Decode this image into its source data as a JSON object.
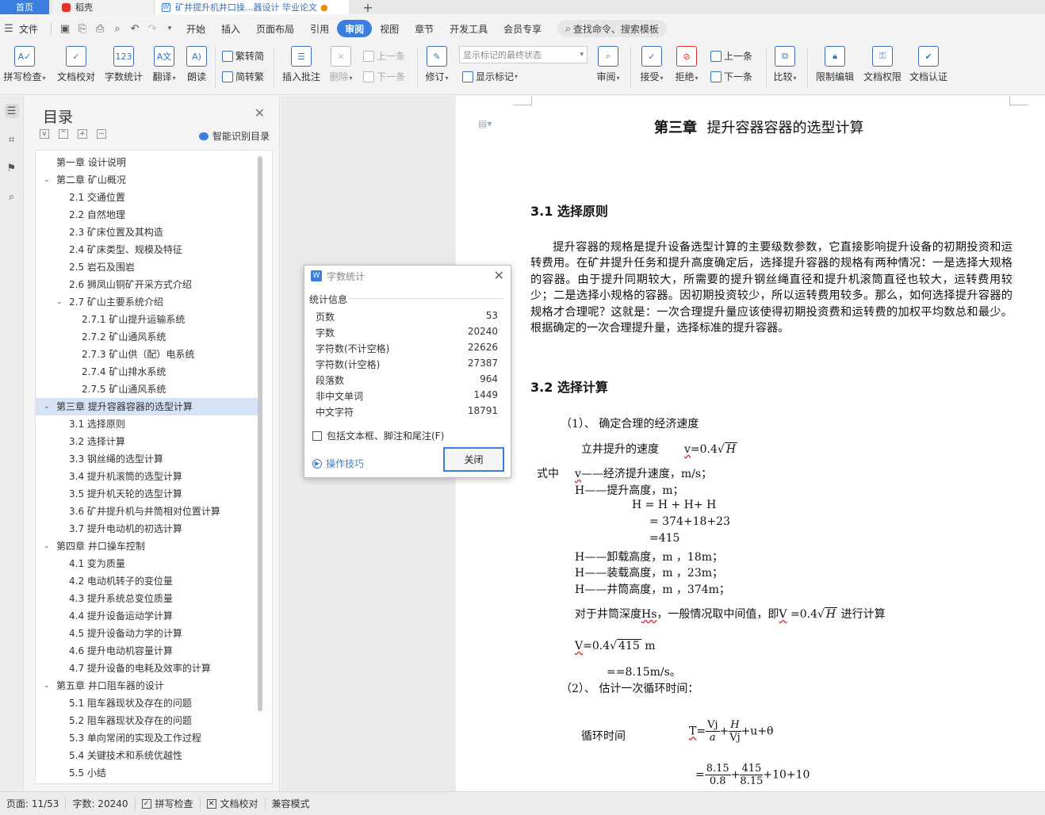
{
  "tabs": {
    "home": "首页",
    "daoke": "稻壳",
    "doc": "矿井提升机井口操...器设计 毕业论文",
    "add": "+"
  },
  "menu": {
    "file": "文件",
    "items": [
      "开始",
      "插入",
      "页面布局",
      "引用",
      "审阅",
      "视图",
      "章节",
      "开发工具",
      "会员专享"
    ],
    "active": "审阅",
    "search": "查找命令、搜索模板"
  },
  "ribbon": {
    "spell": "拼写检查",
    "proof": "文档校对",
    "wordcount": "字数统计",
    "translate": "翻译",
    "read": "朗读",
    "to_simp": "繁转简",
    "to_trad": "简转繁",
    "insert_comment": "插入批注",
    "delete": "删除",
    "prev": "上一条",
    "next": "下一条",
    "revise": "修订",
    "track_state": "显示标记的最终状态",
    "show_mark": "显示标记",
    "review": "审阅",
    "accept": "接受",
    "reject": "拒绝",
    "prev2": "上一条",
    "next2": "下一条",
    "compare": "比较",
    "restrict": "限制编辑",
    "rights": "文档权限",
    "cert": "文档认证"
  },
  "toc": {
    "title": "目录",
    "ai": "智能识别目录",
    "items": [
      {
        "level": 1,
        "text": "第一章  设计说明",
        "chev": ""
      },
      {
        "level": 1,
        "text": "第二章  矿山概况",
        "chev": "v"
      },
      {
        "level": 2,
        "text": "2.1  交通位置",
        "chev": ""
      },
      {
        "level": 2,
        "text": "2.2  自然地理",
        "chev": ""
      },
      {
        "level": 2,
        "text": "2.3  矿床位置及其构造",
        "chev": ""
      },
      {
        "level": 2,
        "text": "2.4  矿床类型、规模及特征",
        "chev": ""
      },
      {
        "level": 2,
        "text": "2.5  岩石及围岩",
        "chev": ""
      },
      {
        "level": 2,
        "text": "2.6  狮凤山铜矿开采方式介绍",
        "chev": ""
      },
      {
        "level": 2,
        "text": "2.7  矿山主要系统介绍",
        "chev": "v"
      },
      {
        "level": 3,
        "text": "2.7.1  矿山提升运输系统",
        "chev": ""
      },
      {
        "level": 3,
        "text": "2.7.2    矿山通风系统",
        "chev": ""
      },
      {
        "level": 3,
        "text": "2.7.3    矿山供（配）电系统",
        "chev": ""
      },
      {
        "level": 3,
        "text": "2.7.4    矿山排水系统",
        "chev": ""
      },
      {
        "level": 3,
        "text": "2.7.5    矿山通风系统",
        "chev": ""
      },
      {
        "level": 1,
        "text": "第三章  提升容器容器的选型计算",
        "chev": "v",
        "selected": true
      },
      {
        "level": 2,
        "text": "3.1  选择原则",
        "chev": ""
      },
      {
        "level": 2,
        "text": "3.2  选择计算",
        "chev": ""
      },
      {
        "level": 2,
        "text": "3.3  钢丝绳的选型计算",
        "chev": ""
      },
      {
        "level": 2,
        "text": "3.4  提升机滚筒的选型计算",
        "chev": ""
      },
      {
        "level": 2,
        "text": "3.5  提升机天轮的选型计算",
        "chev": ""
      },
      {
        "level": 2,
        "text": "3.6  矿井提升机与井筒相对位置计算",
        "chev": ""
      },
      {
        "level": 2,
        "text": "3.7  提升电动机的初选计算",
        "chev": ""
      },
      {
        "level": 1,
        "text": "第四章  井口操车控制",
        "chev": "v"
      },
      {
        "level": 2,
        "text": "4.1  变为质量",
        "chev": ""
      },
      {
        "level": 2,
        "text": "4.2  电动机转子的变位量",
        "chev": ""
      },
      {
        "level": 2,
        "text": "4.3  提升系统总变位质量",
        "chev": ""
      },
      {
        "level": 2,
        "text": "4.4  提升设备运动学计算",
        "chev": ""
      },
      {
        "level": 2,
        "text": "4.5  提升设备动力学的计算",
        "chev": ""
      },
      {
        "level": 2,
        "text": "4.6  提升电动机容量计算",
        "chev": ""
      },
      {
        "level": 2,
        "text": "4.7  提升设备的电耗及效率的计算",
        "chev": ""
      },
      {
        "level": 1,
        "text": "第五章  井口阻车器的设计",
        "chev": "v"
      },
      {
        "level": 2,
        "text": "5.1  阻车器现状及存在的问题",
        "chev": ""
      },
      {
        "level": 2,
        "text": "5.2  阻车器现状及存在的问题",
        "chev": ""
      },
      {
        "level": 2,
        "text": "5.3  单向常闭的实现及工作过程",
        "chev": ""
      },
      {
        "level": 2,
        "text": "5.4  关键技术和系统优越性",
        "chev": ""
      },
      {
        "level": 2,
        "text": "5.5  小结",
        "chev": ""
      }
    ]
  },
  "doc": {
    "chapter_prefix": "第三章",
    "chapter_rest": "提升容器容器的选型计算",
    "sec31": "3.1  选择原则",
    "para": "提升容器的规格是提升设备选型计算的主要级数参数，它直接影响提升设备的初期投资和运转费用。在矿井提升任务和提升高度确定后，选择提升容器的规格有两种情况：一是选择大规格的容器。由于提升同期较大，所需要的提升钢丝绳直径和提升机滚筒直径也较大，运转费用较少；二是选择小规格的容器。因初期投资较少，所以运转费用较多。那么，如何选择提升容器的规格才合理呢？这就是：一次合理提升量应该使得初期投资费和运转费的加权平均数总和最少。根据确定的一次合理提升量，选择标准的提升容器。",
    "sec32": "3.2  选择计算",
    "step1": "（1）、 确定合理的经济速度",
    "speed_label": "立井提升的速度",
    "speed_v": "v",
    "speed_eq": "=0.4",
    "speed_H": "H",
    "where": "式中",
    "v_def_v": "v",
    "v_def": "——经济提升速度，m/s；",
    "h_def": "H——提升高度，m；",
    "h_eq1": "H   =   H  +   H+ H",
    "h_eq2": "=   374+18+23",
    "h_eq3": "=415",
    "h1": "H——卸载高度，m   ，18m；",
    "h2": "H——装载高度，m   ，23m；",
    "h3": "H——井筒高度，m   ，374m；",
    "depth_a": "对于井筒深度",
    "depth_hs": "Hs",
    "depth_b": "，一般情况取中间值，即",
    "depth_v": "V",
    "depth_eq": " =0.4",
    "depth_H": "H",
    "depth_c": "进行计算",
    "vcalc_v": "V",
    "vcalc_eq": "=0.4",
    "vcalc_415": "415",
    "vcalc_m": "m",
    "vresult": "==8.15m/s。",
    "step2": "（2）、 估计一次循环时间：",
    "cycle_label": "循环时间",
    "cycle_t": "T",
    "cycle_eq": "=",
    "cycle_vj": "Vj",
    "cycle_a": "a",
    "cycle_H": "H",
    "cycle_vj2": "Vj",
    "cycle_tail": "+u+θ",
    "cycle2_eq": "=",
    "cycle2_n1": "8.15",
    "cycle2_d1": "0.8",
    "cycle2_n2": "415",
    "cycle2_d2": "8.15",
    "cycle2_tail": "+10+10"
  },
  "dialog": {
    "title": "字数统计",
    "section": "统计信息",
    "stats": [
      {
        "label": "页数",
        "value": "53"
      },
      {
        "label": "字数",
        "value": "20240"
      },
      {
        "label": "字符数(不计空格)",
        "value": "22626"
      },
      {
        "label": "字符数(计空格)",
        "value": "27387"
      },
      {
        "label": "段落数",
        "value": "964"
      },
      {
        "label": "非中文单词",
        "value": "1449"
      },
      {
        "label": "中文字符",
        "value": "18791"
      }
    ],
    "include": "包括文本框、脚注和尾注(F)",
    "tips": "操作技巧",
    "close": "关闭"
  },
  "status": {
    "page": "页面: 11/53",
    "words": "字数: 20240",
    "spell": "拼写检查",
    "proof": "文档校对",
    "compat": "兼容模式"
  },
  "colors": {
    "accent": "#3a7fe0",
    "selected_row": "#d6e2f5"
  }
}
